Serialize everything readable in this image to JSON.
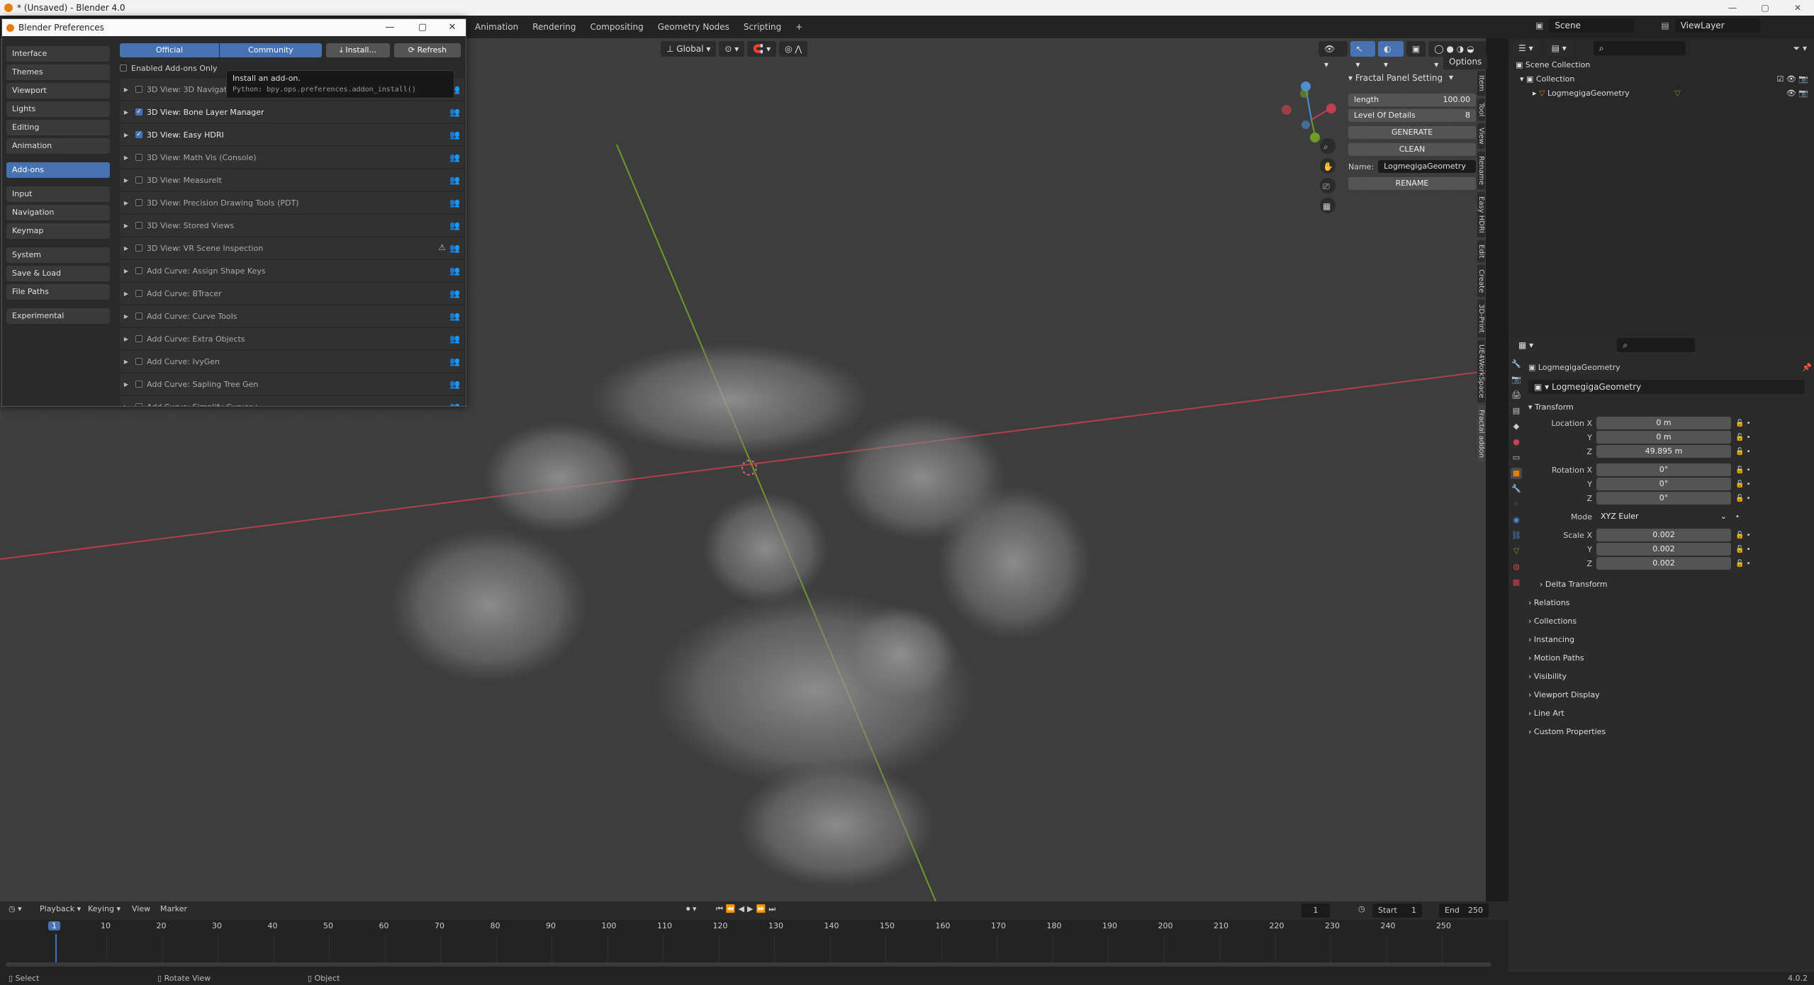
{
  "os_window": {
    "title": "* (Unsaved) - Blender 4.0",
    "min": "—",
    "max": "▢",
    "close": "✕"
  },
  "topbar": {
    "tabs": [
      "Animation",
      "Rendering",
      "Compositing",
      "Geometry Nodes",
      "Scripting"
    ],
    "add_tab": "+",
    "scene": "Scene",
    "view_layer": "ViewLayer"
  },
  "viewport_header": {
    "orientation": "Global",
    "options": "Options"
  },
  "npanel": {
    "title": "Fractal Panel Setting",
    "length_label": "length",
    "length_value": "100.00",
    "lod_label": "Level Of Details",
    "lod_value": "8",
    "generate": "GENERATE",
    "clean": "CLEAN",
    "name_label": "Name:",
    "name_value": "LogmegigaGeometry",
    "rename": "RENAME"
  },
  "sidebar_tabs": [
    "Item",
    "Tool",
    "View",
    "Rename",
    "Easy HDRI",
    "Edit",
    "Create",
    "3D-Print",
    "UE4WorkSpace",
    "Fractal addon"
  ],
  "prefs": {
    "title": "Blender Preferences",
    "nav": [
      "Interface",
      "Themes",
      "Viewport",
      "Lights",
      "Editing",
      "Animation",
      "Add-ons",
      "Input",
      "Navigation",
      "Keymap",
      "System",
      "Save & Load",
      "File Paths",
      "Experimental"
    ],
    "official": "Official",
    "community": "Community",
    "install": "Install...",
    "refresh": "Refresh",
    "enabled_only": "Enabled Add-ons Only",
    "tooltip_title": "Install an add-on.",
    "tooltip_python": "Python: bpy.ops.preferences.addon_install()",
    "addons": [
      {
        "name": "3D View: 3D Navigation",
        "enabled": false
      },
      {
        "name": "3D View: Bone Layer Manager",
        "enabled": true
      },
      {
        "name": "3D View: Easy HDRI",
        "enabled": true
      },
      {
        "name": "3D View: Math Vis (Console)",
        "enabled": false
      },
      {
        "name": "3D View: MeasureIt",
        "enabled": false
      },
      {
        "name": "3D View: Precision Drawing Tools (PDT)",
        "enabled": false
      },
      {
        "name": "3D View: Stored Views",
        "enabled": false
      },
      {
        "name": "3D View: VR Scene Inspection",
        "enabled": false
      },
      {
        "name": "Add Curve: Assign Shape Keys",
        "enabled": false
      },
      {
        "name": "Add Curve: BTracer",
        "enabled": false
      },
      {
        "name": "Add Curve: Curve Tools",
        "enabled": false
      },
      {
        "name": "Add Curve: Extra Objects",
        "enabled": false
      },
      {
        "name": "Add Curve: IvyGen",
        "enabled": false
      },
      {
        "name": "Add Curve: Sapling Tree Gen",
        "enabled": false
      },
      {
        "name": "Add Curve: Simplify Curves+",
        "enabled": false
      }
    ]
  },
  "outliner": {
    "scene_collection": "Scene Collection",
    "collection": "Collection",
    "object": "LogmegigaGeometry"
  },
  "properties": {
    "object_name": "LogmegigaGeometry",
    "data_name": "LogmegigaGeometry",
    "transform": "Transform",
    "location_label": "Location X",
    "loc_x": "0 m",
    "loc_y": "0 m",
    "loc_z": "49.895 m",
    "rotation_label": "Rotation X",
    "rot_x": "0°",
    "rot_y": "0°",
    "rot_z": "0°",
    "mode_label": "Mode",
    "mode_value": "XYZ Euler",
    "scale_label": "Scale X",
    "scale_x": "0.002",
    "scale_y": "0.002",
    "scale_z": "0.002",
    "y": "Y",
    "z": "Z",
    "sections": [
      "Delta Transform",
      "Relations",
      "Collections",
      "Instancing",
      "Motion Paths",
      "Visibility",
      "Viewport Display",
      "Line Art",
      "Custom Properties"
    ]
  },
  "timeline": {
    "menus": [
      "Playback",
      "Keying",
      "View",
      "Marker"
    ],
    "current_frame": "1",
    "start_label": "Start",
    "start": "1",
    "end_label": "End",
    "end": "250",
    "ticks": [
      "10",
      "20",
      "30",
      "40",
      "50",
      "60",
      "70",
      "80",
      "90",
      "100",
      "110",
      "120",
      "130",
      "140",
      "150",
      "160",
      "170",
      "180",
      "190",
      "200",
      "210",
      "220",
      "230",
      "240",
      "250"
    ],
    "playhead": "1"
  },
  "status": {
    "select": "Select",
    "rotate": "Rotate View",
    "object": "Object",
    "version": "4.0.2"
  },
  "colors": {
    "accent": "#4772b3",
    "x_axis": "#d0404a",
    "y_axis": "#7ab32a",
    "z_axis": "#4a8fd6",
    "orange": "#e87d0d"
  }
}
